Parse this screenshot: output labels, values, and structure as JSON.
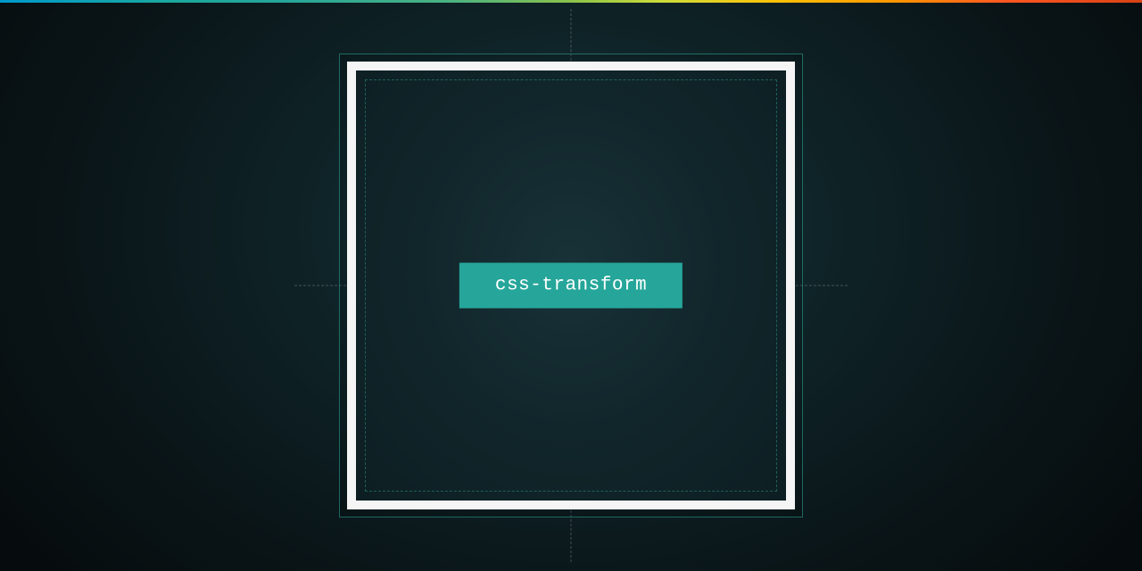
{
  "badge": {
    "label": "css-transform"
  },
  "colors": {
    "accent": "#26a69a",
    "frame": "#f5f5f5"
  }
}
